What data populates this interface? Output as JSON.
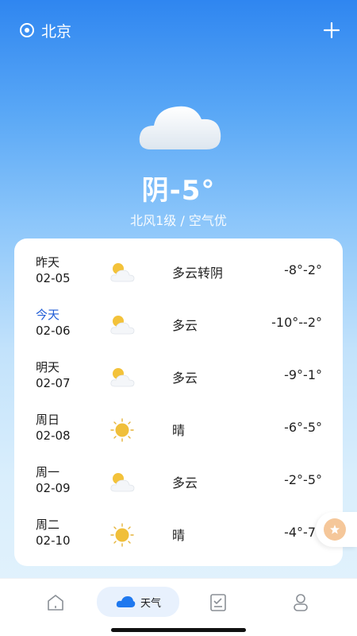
{
  "header": {
    "location": "北京",
    "location_icon": "location-pin-icon",
    "add_icon": "plus-icon"
  },
  "current": {
    "summary": "阴-5°",
    "detail": "北风1级 / 空气优",
    "icon": "cloud-icon"
  },
  "forecast": [
    {
      "day": "昨天",
      "date": "02-05",
      "icon": "partly-cloudy-icon",
      "condition": "多云转阴",
      "range": "-8°-2°",
      "today": false
    },
    {
      "day": "今天",
      "date": "02-06",
      "icon": "partly-cloudy-icon",
      "condition": "多云",
      "range": "-10°--2°",
      "today": true
    },
    {
      "day": "明天",
      "date": "02-07",
      "icon": "partly-cloudy-icon",
      "condition": "多云",
      "range": "-9°-1°",
      "today": false
    },
    {
      "day": "周日",
      "date": "02-08",
      "icon": "sun-icon",
      "condition": "晴",
      "range": "-6°-5°",
      "today": false
    },
    {
      "day": "周一",
      "date": "02-09",
      "icon": "partly-cloudy-icon",
      "condition": "多云",
      "range": "-2°-5°",
      "today": false
    },
    {
      "day": "周二",
      "date": "02-10",
      "icon": "sun-icon",
      "condition": "晴",
      "range": "-4°-7°",
      "today": false
    }
  ],
  "nav": {
    "active_label": "天气",
    "items": [
      "home-icon",
      "weather-icon",
      "checklist-icon",
      "profile-icon"
    ]
  },
  "colors": {
    "today_accent": "#1f5cd6",
    "sky_top": "#2f86f0",
    "sky_bottom": "#e4f3fd"
  }
}
